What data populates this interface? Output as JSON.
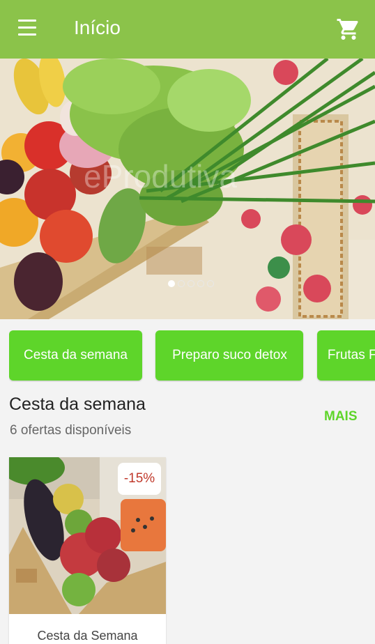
{
  "appbar": {
    "title": "Início",
    "menu_icon": "menu-icon",
    "cart_icon": "cart-icon",
    "color": "#8bc34a"
  },
  "banner": {
    "watermark": "eProdutiva",
    "slides_total": 5,
    "active_slide": 1
  },
  "categories": [
    "Cesta da semana",
    "Preparo suco detox",
    "Frutas F"
  ],
  "section": {
    "title": "Cesta da semana",
    "subtitle": "6 ofertas disponíveis",
    "more_label": "MAIS"
  },
  "products": [
    {
      "name": "Cesta da Semana",
      "discount": "-15%"
    }
  ],
  "colors": {
    "accent": "#5ed52a",
    "discount": "#c0392b"
  }
}
